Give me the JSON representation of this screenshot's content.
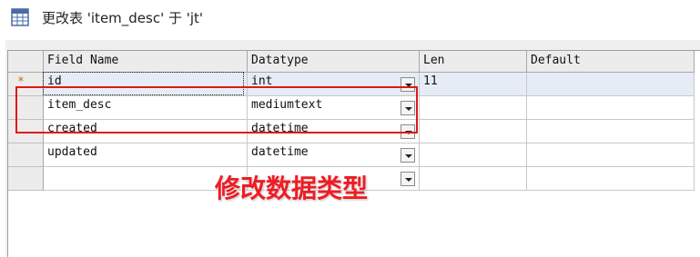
{
  "window": {
    "title": "更改表 'item_desc' 于 'jt'",
    "icon": "table-icon"
  },
  "grid": {
    "columns": [
      "Field Name",
      "Datatype",
      "Len",
      "Default"
    ],
    "new_row_marker": "*",
    "rows": [
      {
        "field": "id",
        "datatype": "int",
        "len": "11",
        "default": ""
      },
      {
        "field": "item_desc",
        "datatype": "mediumtext",
        "len": "",
        "default": ""
      },
      {
        "field": "created",
        "datatype": "datetime",
        "len": "",
        "default": ""
      },
      {
        "field": "updated",
        "datatype": "datetime",
        "len": "",
        "default": ""
      },
      {
        "field": "",
        "datatype": "",
        "len": "",
        "default": ""
      }
    ]
  },
  "annotation": {
    "text": "修改数据类型",
    "color": "#ee1c24"
  }
}
